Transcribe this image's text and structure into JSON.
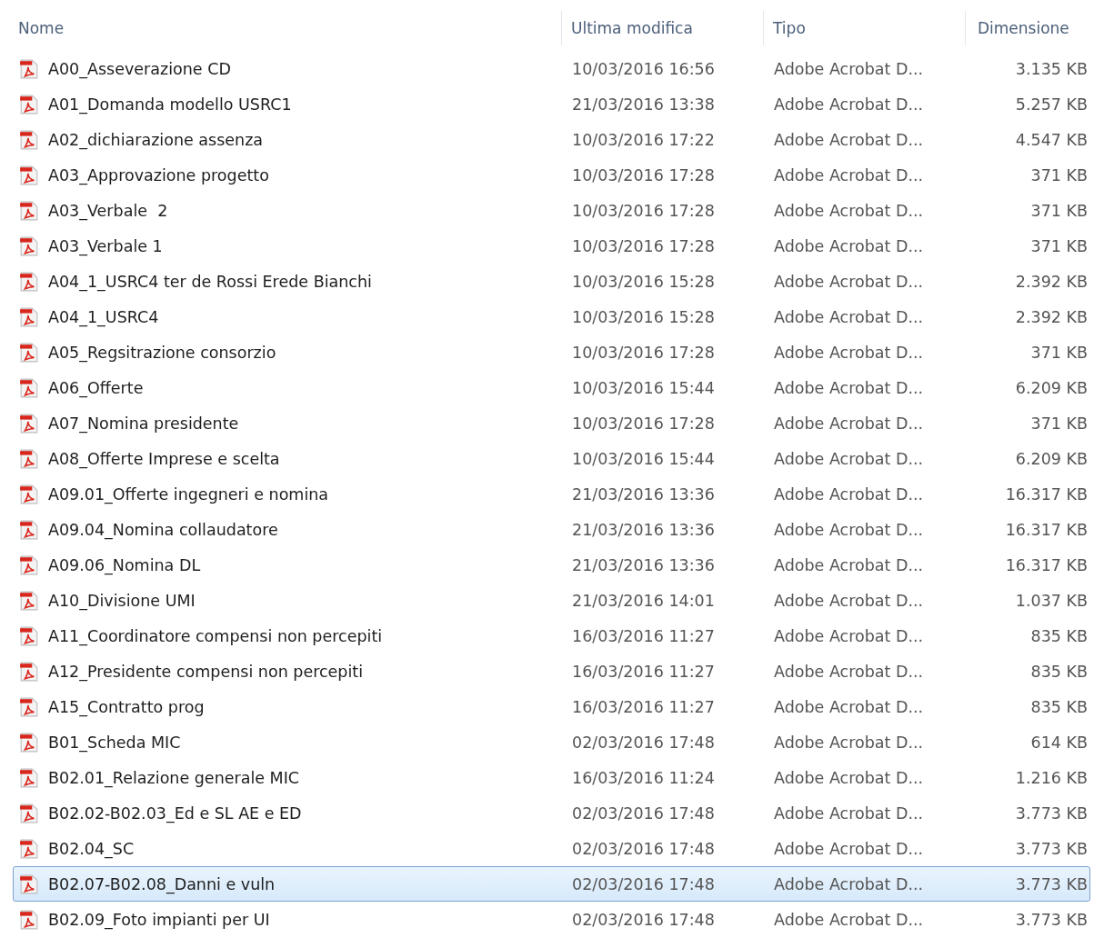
{
  "columns": [
    "Nome",
    "Ultima modifica",
    "Tipo",
    "Dimensione"
  ],
  "rows": [
    {
      "name": "A00_Asseverazione CD",
      "modified": "10/03/2016 16:56",
      "type": "Adobe Acrobat D...",
      "size": "3.135 KB",
      "selected": false
    },
    {
      "name": "A01_Domanda modello USRC1",
      "modified": "21/03/2016 13:38",
      "type": "Adobe Acrobat D...",
      "size": "5.257 KB",
      "selected": false
    },
    {
      "name": "A02_dichiarazione assenza",
      "modified": "10/03/2016 17:22",
      "type": "Adobe Acrobat D...",
      "size": "4.547 KB",
      "selected": false
    },
    {
      "name": "A03_Approvazione progetto",
      "modified": "10/03/2016 17:28",
      "type": "Adobe Acrobat D...",
      "size": "371 KB",
      "selected": false
    },
    {
      "name": "A03_Verbale  2",
      "modified": "10/03/2016 17:28",
      "type": "Adobe Acrobat D...",
      "size": "371 KB",
      "selected": false
    },
    {
      "name": "A03_Verbale 1",
      "modified": "10/03/2016 17:28",
      "type": "Adobe Acrobat D...",
      "size": "371 KB",
      "selected": false
    },
    {
      "name": "A04_1_USRC4 ter de Rossi Erede Bianchi",
      "modified": "10/03/2016 15:28",
      "type": "Adobe Acrobat D...",
      "size": "2.392 KB",
      "selected": false
    },
    {
      "name": "A04_1_USRC4",
      "modified": "10/03/2016 15:28",
      "type": "Adobe Acrobat D...",
      "size": "2.392 KB",
      "selected": false
    },
    {
      "name": "A05_Regsitrazione consorzio",
      "modified": "10/03/2016 17:28",
      "type": "Adobe Acrobat D...",
      "size": "371 KB",
      "selected": false
    },
    {
      "name": "A06_Offerte",
      "modified": "10/03/2016 15:44",
      "type": "Adobe Acrobat D...",
      "size": "6.209 KB",
      "selected": false
    },
    {
      "name": "A07_Nomina presidente",
      "modified": "10/03/2016 17:28",
      "type": "Adobe Acrobat D...",
      "size": "371 KB",
      "selected": false
    },
    {
      "name": "A08_Offerte Imprese e scelta",
      "modified": "10/03/2016 15:44",
      "type": "Adobe Acrobat D...",
      "size": "6.209 KB",
      "selected": false
    },
    {
      "name": "A09.01_Offerte ingegneri e nomina",
      "modified": "21/03/2016 13:36",
      "type": "Adobe Acrobat D...",
      "size": "16.317 KB",
      "selected": false
    },
    {
      "name": "A09.04_Nomina collaudatore",
      "modified": "21/03/2016 13:36",
      "type": "Adobe Acrobat D...",
      "size": "16.317 KB",
      "selected": false
    },
    {
      "name": "A09.06_Nomina DL",
      "modified": "21/03/2016 13:36",
      "type": "Adobe Acrobat D...",
      "size": "16.317 KB",
      "selected": false
    },
    {
      "name": "A10_Divisione UMI",
      "modified": "21/03/2016 14:01",
      "type": "Adobe Acrobat D...",
      "size": "1.037 KB",
      "selected": false
    },
    {
      "name": "A11_Coordinatore compensi non percepiti",
      "modified": "16/03/2016 11:27",
      "type": "Adobe Acrobat D...",
      "size": "835 KB",
      "selected": false
    },
    {
      "name": "A12_Presidente compensi non percepiti",
      "modified": "16/03/2016 11:27",
      "type": "Adobe Acrobat D...",
      "size": "835 KB",
      "selected": false
    },
    {
      "name": "A15_Contratto prog",
      "modified": "16/03/2016 11:27",
      "type": "Adobe Acrobat D...",
      "size": "835 KB",
      "selected": false
    },
    {
      "name": "B01_Scheda MIC",
      "modified": "02/03/2016 17:48",
      "type": "Adobe Acrobat D...",
      "size": "614 KB",
      "selected": false
    },
    {
      "name": "B02.01_Relazione generale MIC",
      "modified": "16/03/2016 11:24",
      "type": "Adobe Acrobat D...",
      "size": "1.216 KB",
      "selected": false
    },
    {
      "name": "B02.02-B02.03_Ed e SL AE e ED",
      "modified": "02/03/2016 17:48",
      "type": "Adobe Acrobat D...",
      "size": "3.773 KB",
      "selected": false
    },
    {
      "name": "B02.04_SC",
      "modified": "02/03/2016 17:48",
      "type": "Adobe Acrobat D...",
      "size": "3.773 KB",
      "selected": false
    },
    {
      "name": "B02.07-B02.08_Danni e vuln",
      "modified": "02/03/2016 17:48",
      "type": "Adobe Acrobat D...",
      "size": "3.773 KB",
      "selected": true
    },
    {
      "name": "B02.09_Foto impianti per UI",
      "modified": "02/03/2016 17:48",
      "type": "Adobe Acrobat D...",
      "size": "3.773 KB",
      "selected": false
    }
  ]
}
